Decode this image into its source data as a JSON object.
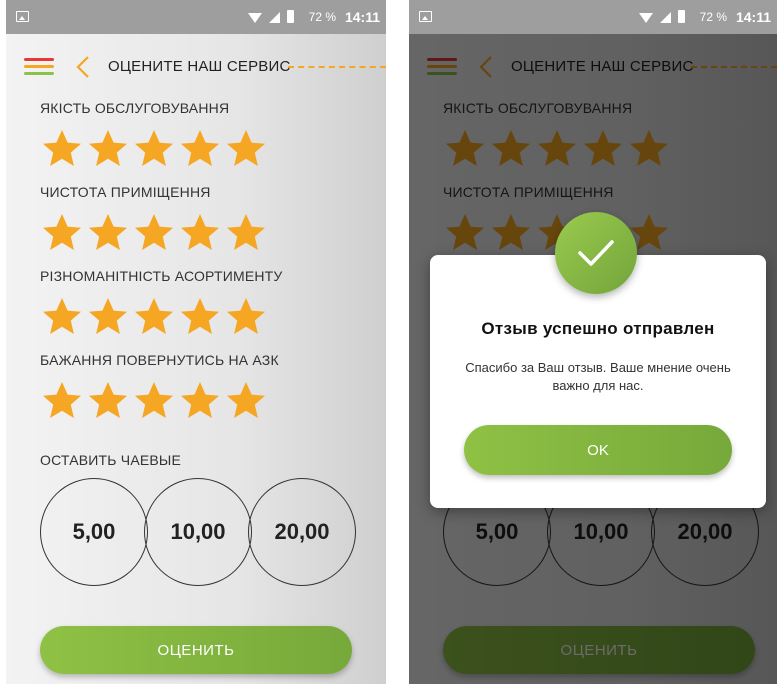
{
  "status_bar": {
    "battery": "72 %",
    "time": "14:11"
  },
  "header": {
    "title": "ОЦЕНИТЕ НАШ СЕРВИС"
  },
  "ratings": [
    {
      "label": "ЯКІСТЬ ОБСЛУГОВУВАННЯ",
      "stars": 5,
      "max": 5
    },
    {
      "label": "ЧИСТОТА ПРИМІЩЕННЯ",
      "stars": 5,
      "max": 5
    },
    {
      "label": "РІЗНОМАНІТНІСТЬ АСОРТИМЕНТУ",
      "stars": 5,
      "max": 5
    },
    {
      "label": "БАЖАННЯ ПОВЕРНУТИСЬ НА АЗК",
      "stars": 5,
      "max": 5
    }
  ],
  "tips": {
    "label": "ОСТАВИТЬ ЧАЕВЫЕ",
    "options": [
      "5,00",
      "10,00",
      "20,00"
    ]
  },
  "rate_button": "ОЦЕНИТЬ",
  "dialog": {
    "title": "Отзыв успешно отправлен",
    "message": "Спасибо за Ваш отзыв. Ваше мнение очень важно для нас.",
    "ok_button": "OK"
  },
  "colors": {
    "accent_green": "#8fc145",
    "star_orange": "#f5a623",
    "menu_red": "#e53935",
    "menu_orange": "#f5a623",
    "menu_green": "#8bc34a"
  },
  "icons": [
    "image-icon",
    "wifi-icon",
    "signal-icon",
    "battery-icon",
    "menu-icon",
    "back-chevron-icon",
    "star-icon",
    "check-icon"
  ]
}
